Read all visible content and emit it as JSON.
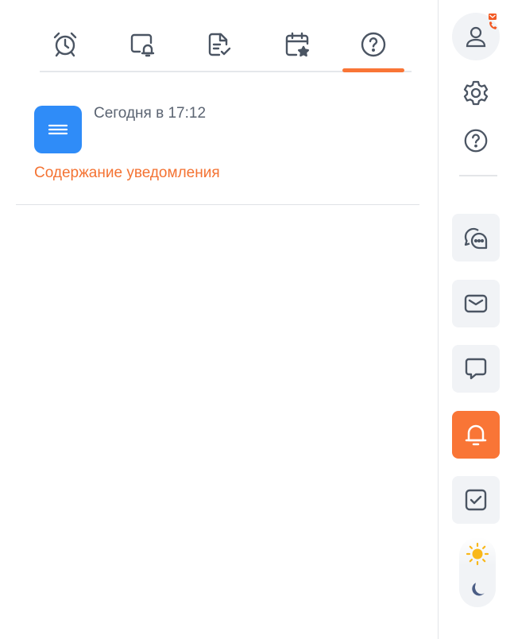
{
  "tabs": {
    "items": [
      {
        "icon": "alarm-clock-icon"
      },
      {
        "icon": "screen-bell-icon"
      },
      {
        "icon": "document-check-icon"
      },
      {
        "icon": "calendar-star-icon"
      },
      {
        "icon": "help-circle-icon"
      }
    ],
    "active_index": 4,
    "accent_color": "#f97536"
  },
  "notification": {
    "icon": "menu-lines-icon",
    "icon_color": "#2f8cf8",
    "time": "Сегодня в 17:12",
    "content": "Содержание уведомления",
    "content_color": "#f47333"
  },
  "sidebar": {
    "top_icons": [
      "user-avatar-icon",
      "settings-gear-icon",
      "help-circle-icon"
    ],
    "buttons": [
      {
        "icon": "chat-bubbles-icon",
        "active": false
      },
      {
        "icon": "mail-icon",
        "active": false
      },
      {
        "icon": "comment-icon",
        "active": false
      },
      {
        "icon": "bell-icon",
        "active": true
      },
      {
        "icon": "checkbox-icon",
        "active": false
      }
    ],
    "theme_toggle": {
      "options": [
        "sun-icon",
        "moon-icon"
      ],
      "selected": "sun-icon"
    }
  }
}
